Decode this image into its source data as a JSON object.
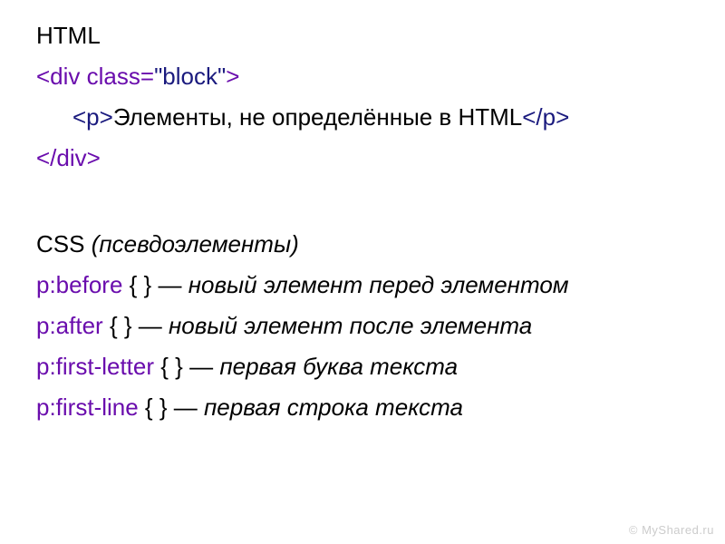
{
  "html_section": {
    "title": "HTML",
    "line1": {
      "open": "<div class=",
      "attr": "\"block\"",
      "close": ">"
    },
    "line2": {
      "open": "<p>",
      "text": "Элементы, не определённые в HTML",
      "close": "</p>"
    },
    "line3": "</div>"
  },
  "css_section": {
    "title": "CSS ",
    "title_italic": "(псевдоэлементы)",
    "rules": [
      {
        "selector": "p:before",
        "braces": " { } ",
        "dash": "— ",
        "desc": "новый элемент перед элементом"
      },
      {
        "selector": "p:after",
        "braces": " { } ",
        "dash": "— ",
        "desc": "новый элемент после элемента"
      },
      {
        "selector": "p:first-letter",
        "braces": " { } ",
        "dash": "— ",
        "desc": "первая буква текста"
      },
      {
        "selector": "p:first-line",
        "braces": " { } ",
        "dash": "— ",
        "desc": "первая строка текста"
      }
    ]
  },
  "watermark": "© MyShared.ru"
}
